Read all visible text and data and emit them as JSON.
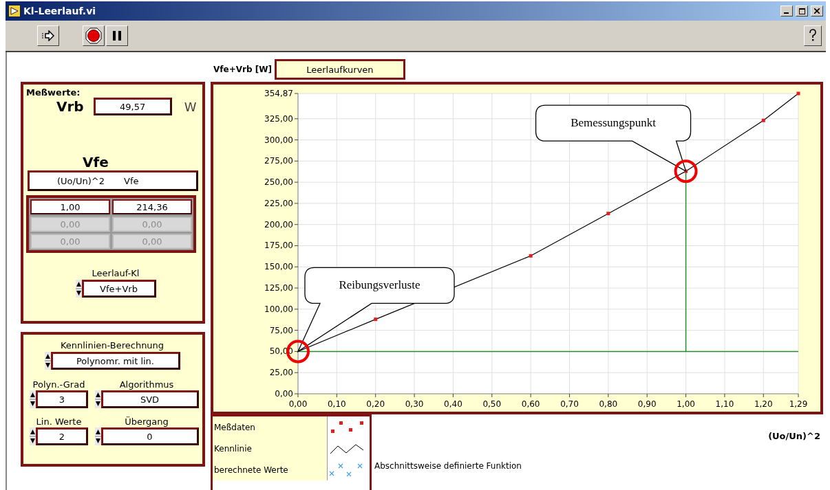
{
  "window": {
    "title": "Kl-Leerlauf.vi"
  },
  "measurements": {
    "title": "Meßwerte:",
    "vrb": {
      "label": "Vrb",
      "value": "49,57",
      "unit": "W"
    },
    "vfe": {
      "label": "Vfe",
      "columns": [
        "(Uo/Un)^2",
        "Vfe"
      ],
      "rows": [
        {
          "cells": [
            "1,00",
            "214,36"
          ],
          "disabled": false
        },
        {
          "cells": [
            "0,00",
            "0,00"
          ],
          "disabled": true
        },
        {
          "cells": [
            "0,00",
            "0,00"
          ],
          "disabled": true
        }
      ]
    },
    "curve_select": {
      "label": "Leerlauf-Kl",
      "value": "Vfe+Vrb"
    }
  },
  "settings": {
    "calc": {
      "label": "Kennlinien-Berechnung",
      "value": "Polynomr. mit lin."
    },
    "fields": [
      {
        "label": "Polyn.-Grad",
        "value": "3"
      },
      {
        "label": "Algorithmus",
        "value": "SVD"
      },
      {
        "label": "Lin. Werte",
        "value": "2"
      },
      {
        "label": "Übergang",
        "value": "0"
      }
    ]
  },
  "chart": {
    "chart_data": {
      "type": "line",
      "title": "Leerlaufkurven",
      "xlabel": "(Uo/Un)^2",
      "ylabel": "Vfe+Vrb [W]",
      "grid": true,
      "x": [
        0,
        0.2,
        0.4,
        0.6,
        0.8,
        1.0,
        1.2,
        1.29
      ],
      "series": [
        {
          "name": "Kennlinie",
          "color": "#000000",
          "type": "line",
          "values": [
            50,
            88,
            null,
            163,
            213,
            263,
            323,
            354.87
          ]
        },
        {
          "name": "Meßdaten",
          "color": "#e02020",
          "type": "scatter",
          "values": [
            null,
            88,
            null,
            163,
            213,
            263,
            323,
            354.87
          ]
        }
      ],
      "xlim": [
        0,
        1.29
      ],
      "ylim": [
        0,
        354.87
      ],
      "xticks": [
        {
          "value": 0,
          "label": "0,00"
        },
        {
          "value": 0.1,
          "label": "0,10"
        },
        {
          "value": 0.2,
          "label": "0,20"
        },
        {
          "value": 0.3,
          "label": "0,30"
        },
        {
          "value": 0.4,
          "label": "0,40"
        },
        {
          "value": 0.5,
          "label": "0,50"
        },
        {
          "value": 0.6,
          "label": "0,60"
        },
        {
          "value": 0.7,
          "label": "0,70"
        },
        {
          "value": 0.8,
          "label": "0,80"
        },
        {
          "value": 0.9,
          "label": "0,90"
        },
        {
          "value": 1.0,
          "label": "1,00"
        },
        {
          "value": 1.1,
          "label": "1,10"
        },
        {
          "value": 1.2,
          "label": "1,20"
        },
        {
          "value": 1.29,
          "label": "1,29"
        }
      ],
      "yticks": [
        {
          "value": 0,
          "label": "0,00"
        },
        {
          "value": 25,
          "label": "25,00"
        },
        {
          "value": 50,
          "label": "50,00"
        },
        {
          "value": 75,
          "label": "75,00"
        },
        {
          "value": 100,
          "label": "100,00"
        },
        {
          "value": 125,
          "label": "125,00"
        },
        {
          "value": 150,
          "label": "150,00"
        },
        {
          "value": 175,
          "label": "175,00"
        },
        {
          "value": 200,
          "label": "200,00"
        },
        {
          "value": 225,
          "label": "225,00"
        },
        {
          "value": 250,
          "label": "250,00"
        },
        {
          "value": 275,
          "label": "275,00"
        },
        {
          "value": 300,
          "label": "300,00"
        },
        {
          "value": 325,
          "label": "325,00"
        },
        {
          "value": 354.87,
          "label": "354,87"
        }
      ],
      "ref_lines": [
        {
          "axis": "y",
          "value": 50,
          "color": "#2a8a2a"
        },
        {
          "axis": "x",
          "value": 1.0,
          "color": "#2a8a2a"
        }
      ],
      "annotations": [
        "Reibungsverluste",
        "Bemessungspunkt"
      ]
    },
    "legend_extra": [
      {
        "label": "berechnete Werte",
        "color": "#3aa0e0"
      }
    ],
    "legend_note": "Abschnittsweise definierte Funktion"
  }
}
